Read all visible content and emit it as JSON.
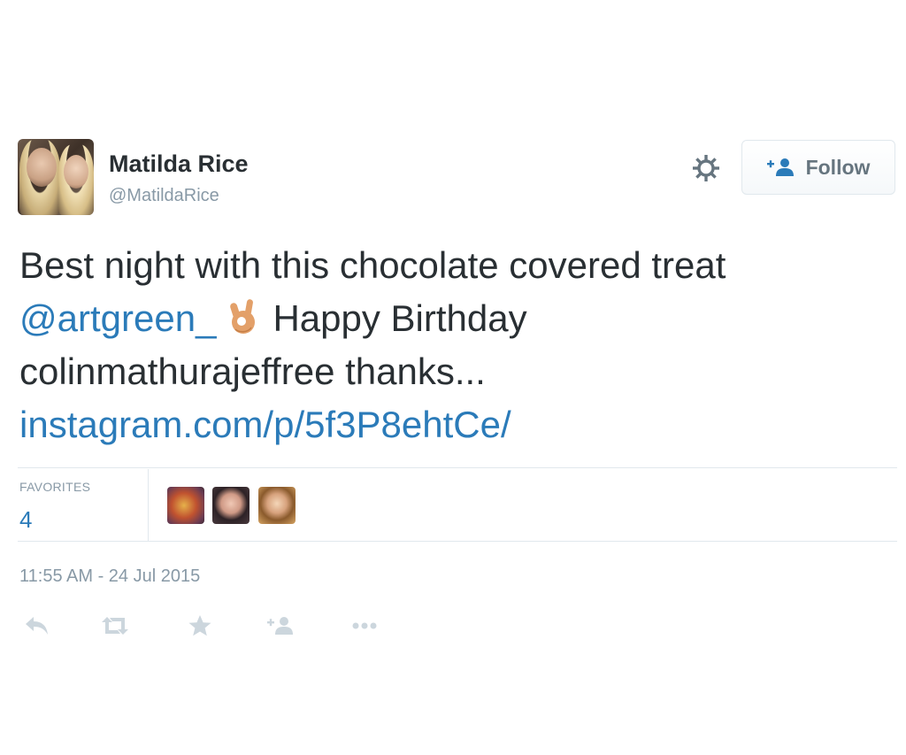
{
  "tweet": {
    "user": {
      "name": "Matilda Rice",
      "handle": "@MatildaRice",
      "avatar_icon": "profile-photo"
    },
    "follow_button": {
      "label": "Follow",
      "icon": "add-user-icon"
    },
    "settings_icon": "gear-icon",
    "text": {
      "line1": "Best night with this chocolate covered treat",
      "mention": "@artgreen_",
      "emoji_icon": "ok-hand-emoji",
      "line2_rest": "Happy Birthday",
      "line3": "colinmathurajeffree thanks...",
      "link": "instagram.com/p/5f3P8ehtCe/"
    },
    "stats": {
      "favorites_label": "FAVORITES",
      "favorites_count": "4",
      "favoriter_avatars": [
        "favoriter-avatar-1",
        "favoriter-avatar-2",
        "favoriter-avatar-3"
      ]
    },
    "timestamp": "11:55 AM - 24 Jul 2015",
    "actions": [
      "reply-icon",
      "retweet-icon",
      "favorite-icon",
      "follow-icon",
      "more-icon"
    ],
    "colors": {
      "link": "#2b7bb9",
      "text": "#292f33",
      "muted": "#8899a6",
      "divider": "#e1e8ed"
    }
  }
}
